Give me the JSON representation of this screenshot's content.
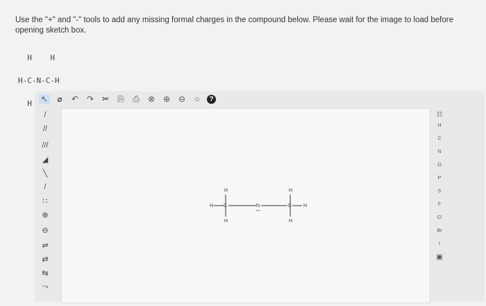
{
  "question": {
    "instructions": "Use the \"+\" and \"-\" tools to add any missing formal charges in the compound below. Please wait for the image to load before opening sketch box.",
    "formula_lines": [
      "  H    H",
      "H-C-N-C-H",
      "  H    H"
    ]
  },
  "toolbar": {
    "tools": [
      {
        "name": "select-tool-icon",
        "glyph": "↖"
      },
      {
        "name": "erase-tool-icon",
        "glyph": "⌀"
      },
      {
        "name": "undo-icon",
        "glyph": "↶"
      },
      {
        "name": "redo-icon",
        "glyph": "↷"
      },
      {
        "name": "cut-icon",
        "glyph": "✂"
      },
      {
        "name": "copy-icon",
        "glyph": "⎘"
      },
      {
        "name": "paste-icon",
        "glyph": "⎙"
      },
      {
        "name": "zoom-reset-icon",
        "glyph": "⊗"
      },
      {
        "name": "zoom-in-icon",
        "glyph": "⊕"
      },
      {
        "name": "zoom-out-icon",
        "glyph": "⊖"
      },
      {
        "name": "zoom-fit-icon",
        "glyph": "○"
      },
      {
        "name": "help-icon",
        "glyph": "?"
      }
    ]
  },
  "left_tools": [
    {
      "name": "single-bond-tool",
      "glyph": "/"
    },
    {
      "name": "double-bond-tool",
      "glyph": "//"
    },
    {
      "name": "triple-bond-tool",
      "glyph": "///"
    },
    {
      "name": "wedge-bond-tool",
      "glyph": "◢"
    },
    {
      "name": "hash-bond-tool",
      "glyph": "╲"
    },
    {
      "name": "chain-tool",
      "glyph": "/"
    },
    {
      "name": "lone-pair-tool",
      "glyph": "∷"
    },
    {
      "name": "plus-charge-tool",
      "glyph": "⊕"
    },
    {
      "name": "minus-charge-tool",
      "glyph": "⊖"
    },
    {
      "name": "arrow-tool-1",
      "glyph": "⇌"
    },
    {
      "name": "arrow-tool-2",
      "glyph": "⇄"
    },
    {
      "name": "arrow-tool-3",
      "glyph": "⇆"
    },
    {
      "name": "curved-arrow-tool",
      "glyph": "⤳"
    }
  ],
  "right_tools": [
    {
      "name": "periodic-table-button",
      "label": "☷"
    },
    {
      "name": "atom-H",
      "label": "H"
    },
    {
      "name": "atom-C",
      "label": "C"
    },
    {
      "name": "atom-N",
      "label": "N"
    },
    {
      "name": "atom-O",
      "label": "O"
    },
    {
      "name": "atom-P",
      "label": "P"
    },
    {
      "name": "atom-S",
      "label": "S"
    },
    {
      "name": "atom-F",
      "label": "F"
    },
    {
      "name": "atom-Cl",
      "label": "Cl"
    },
    {
      "name": "atom-Br",
      "label": "Br"
    },
    {
      "name": "atom-I",
      "label": "I"
    },
    {
      "name": "more-atoms-button",
      "label": "▣"
    }
  ],
  "molecule": {
    "atoms": {
      "c1": "C",
      "n": "N",
      "c2": "C",
      "h": "H"
    }
  }
}
